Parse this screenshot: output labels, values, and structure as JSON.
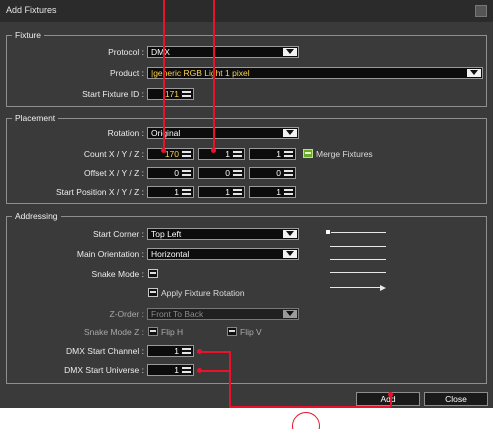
{
  "window": {
    "title": "Add Fixtures"
  },
  "fixture": {
    "group_label": "Fixture",
    "protocol_label": "Protocol :",
    "protocol_value": "DMX",
    "product_label": "Product :",
    "product_value": "|generic RGB Light 1 pixel",
    "start_id_label": "Start Fixture ID :",
    "start_id_value": "171"
  },
  "placement": {
    "group_label": "Placement",
    "rotation_label": "Rotation :",
    "rotation_value": "Original",
    "count_label": "Count X / Y / Z :",
    "count_x": "170",
    "count_y": "1",
    "count_z": "1",
    "merge_label": "Merge Fixtures",
    "offset_label": "Offset X / Y / Z :",
    "offset_x": "0",
    "offset_y": "0",
    "offset_z": "0",
    "startpos_label": "Start Position X / Y / Z :",
    "startpos_x": "1",
    "startpos_y": "1",
    "startpos_z": "1"
  },
  "addressing": {
    "group_label": "Addressing",
    "start_corner_label": "Start Corner :",
    "start_corner_value": "Top Left",
    "orientation_label": "Main Orientation :",
    "orientation_value": "Horizontal",
    "snake_label": "Snake Mode :",
    "apply_rotation_label": "Apply Fixture Rotation",
    "zorder_label": "Z-Order :",
    "zorder_value": "Front To Back",
    "snake_z_label": "Snake Mode Z :",
    "flip_h_label": "Flip H",
    "flip_v_label": "Flip V",
    "dmx_channel_label": "DMX Start Channel :",
    "dmx_channel_value": "1",
    "dmx_universe_label": "DMX Start Universe :",
    "dmx_universe_value": "1"
  },
  "buttons": {
    "add_label": "Add",
    "close_label": "Close"
  },
  "colors": {
    "annotation": "#e8132b",
    "highlight_text": "#ffd54a",
    "merge_check": "#6aaa2a"
  }
}
